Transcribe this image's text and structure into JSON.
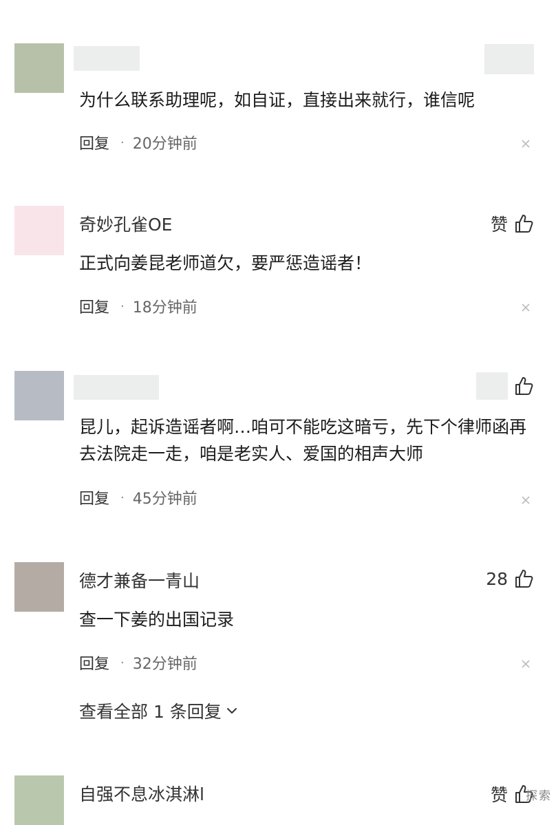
{
  "comments": [
    {
      "name": "",
      "avatar_color": "#b7c1aa",
      "content": "为什么联系助理呢，如自证，直接出来就行，谁信呢",
      "reply": "回复",
      "time": "20分钟前",
      "like_text": ""
    },
    {
      "name": "奇妙孔雀OE",
      "avatar_color": "#f9e4ea",
      "content": "正式向姜昆老师道欠，要严惩造谣者！",
      "reply": "回复",
      "time": "18分钟前",
      "like_text": "赞"
    },
    {
      "name": "",
      "avatar_color": "#b7bcc4",
      "content": "昆儿，起诉造谣者啊…咱可不能吃这暗亏，先下个律师函再去法院走一走，咱是老实人、爱国的相声大师",
      "reply": "回复",
      "time": "45分钟前",
      "like_text": ""
    },
    {
      "name": "德才兼备一青山",
      "avatar_color": "#b4aba4",
      "content": "查一下姜的出国记录",
      "reply": "回复",
      "time": "32分钟前",
      "like_text": "28",
      "view_all": "查看全部 1 条回复"
    },
    {
      "name": "自强不息冰淇淋l",
      "avatar_color": "#b9c8ad",
      "like_text": "赞"
    }
  ],
  "icons": {
    "like": "thumbs-up-icon",
    "close": "close-icon",
    "chevron": "chevron-down-icon"
  },
  "watermark": "探索"
}
